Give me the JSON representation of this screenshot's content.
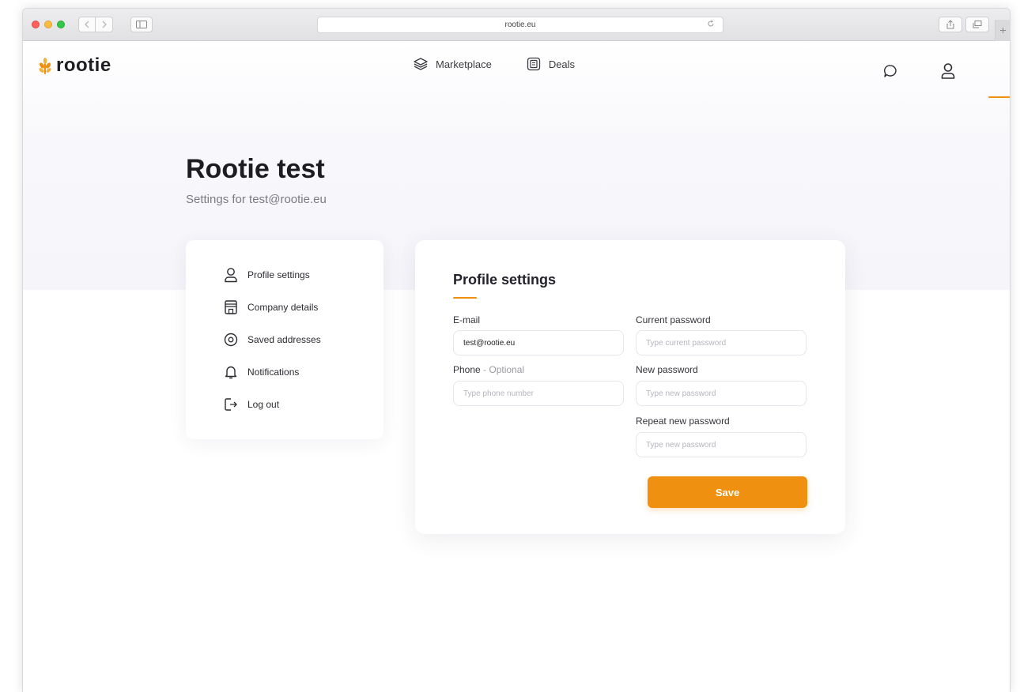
{
  "browser": {
    "url": "rootie.eu"
  },
  "brand": {
    "name": "rootie",
    "accent_color": "#ef9010"
  },
  "topnav": {
    "items": [
      {
        "label": "Marketplace",
        "icon": "layers-icon"
      },
      {
        "label": "Deals",
        "icon": "deals-document-icon"
      }
    ]
  },
  "header_icons": {
    "messages": "chat-bubble-icon",
    "account": "user-icon"
  },
  "page": {
    "title": "Rootie test",
    "subtitle": "Settings for test@rootie.eu"
  },
  "sidebar": {
    "items": [
      {
        "label": "Profile settings",
        "icon": "user-icon"
      },
      {
        "label": "Company details",
        "icon": "building-icon"
      },
      {
        "label": "Saved addresses",
        "icon": "location-pin-icon"
      },
      {
        "label": "Notifications",
        "icon": "bell-icon"
      },
      {
        "label": "Log out",
        "icon": "logout-icon"
      }
    ]
  },
  "form": {
    "title": "Profile settings",
    "email": {
      "label": "E-mail",
      "value": "test@rootie.eu"
    },
    "phone": {
      "label": "Phone",
      "optional_text": "- Optional",
      "placeholder": "Type phone number"
    },
    "current_password": {
      "label": "Current password",
      "placeholder": "Type current password"
    },
    "new_password": {
      "label": "New password",
      "placeholder": "Type new password"
    },
    "repeat_password": {
      "label": "Repeat new password",
      "placeholder": "Type new password"
    },
    "save_label": "Save"
  }
}
